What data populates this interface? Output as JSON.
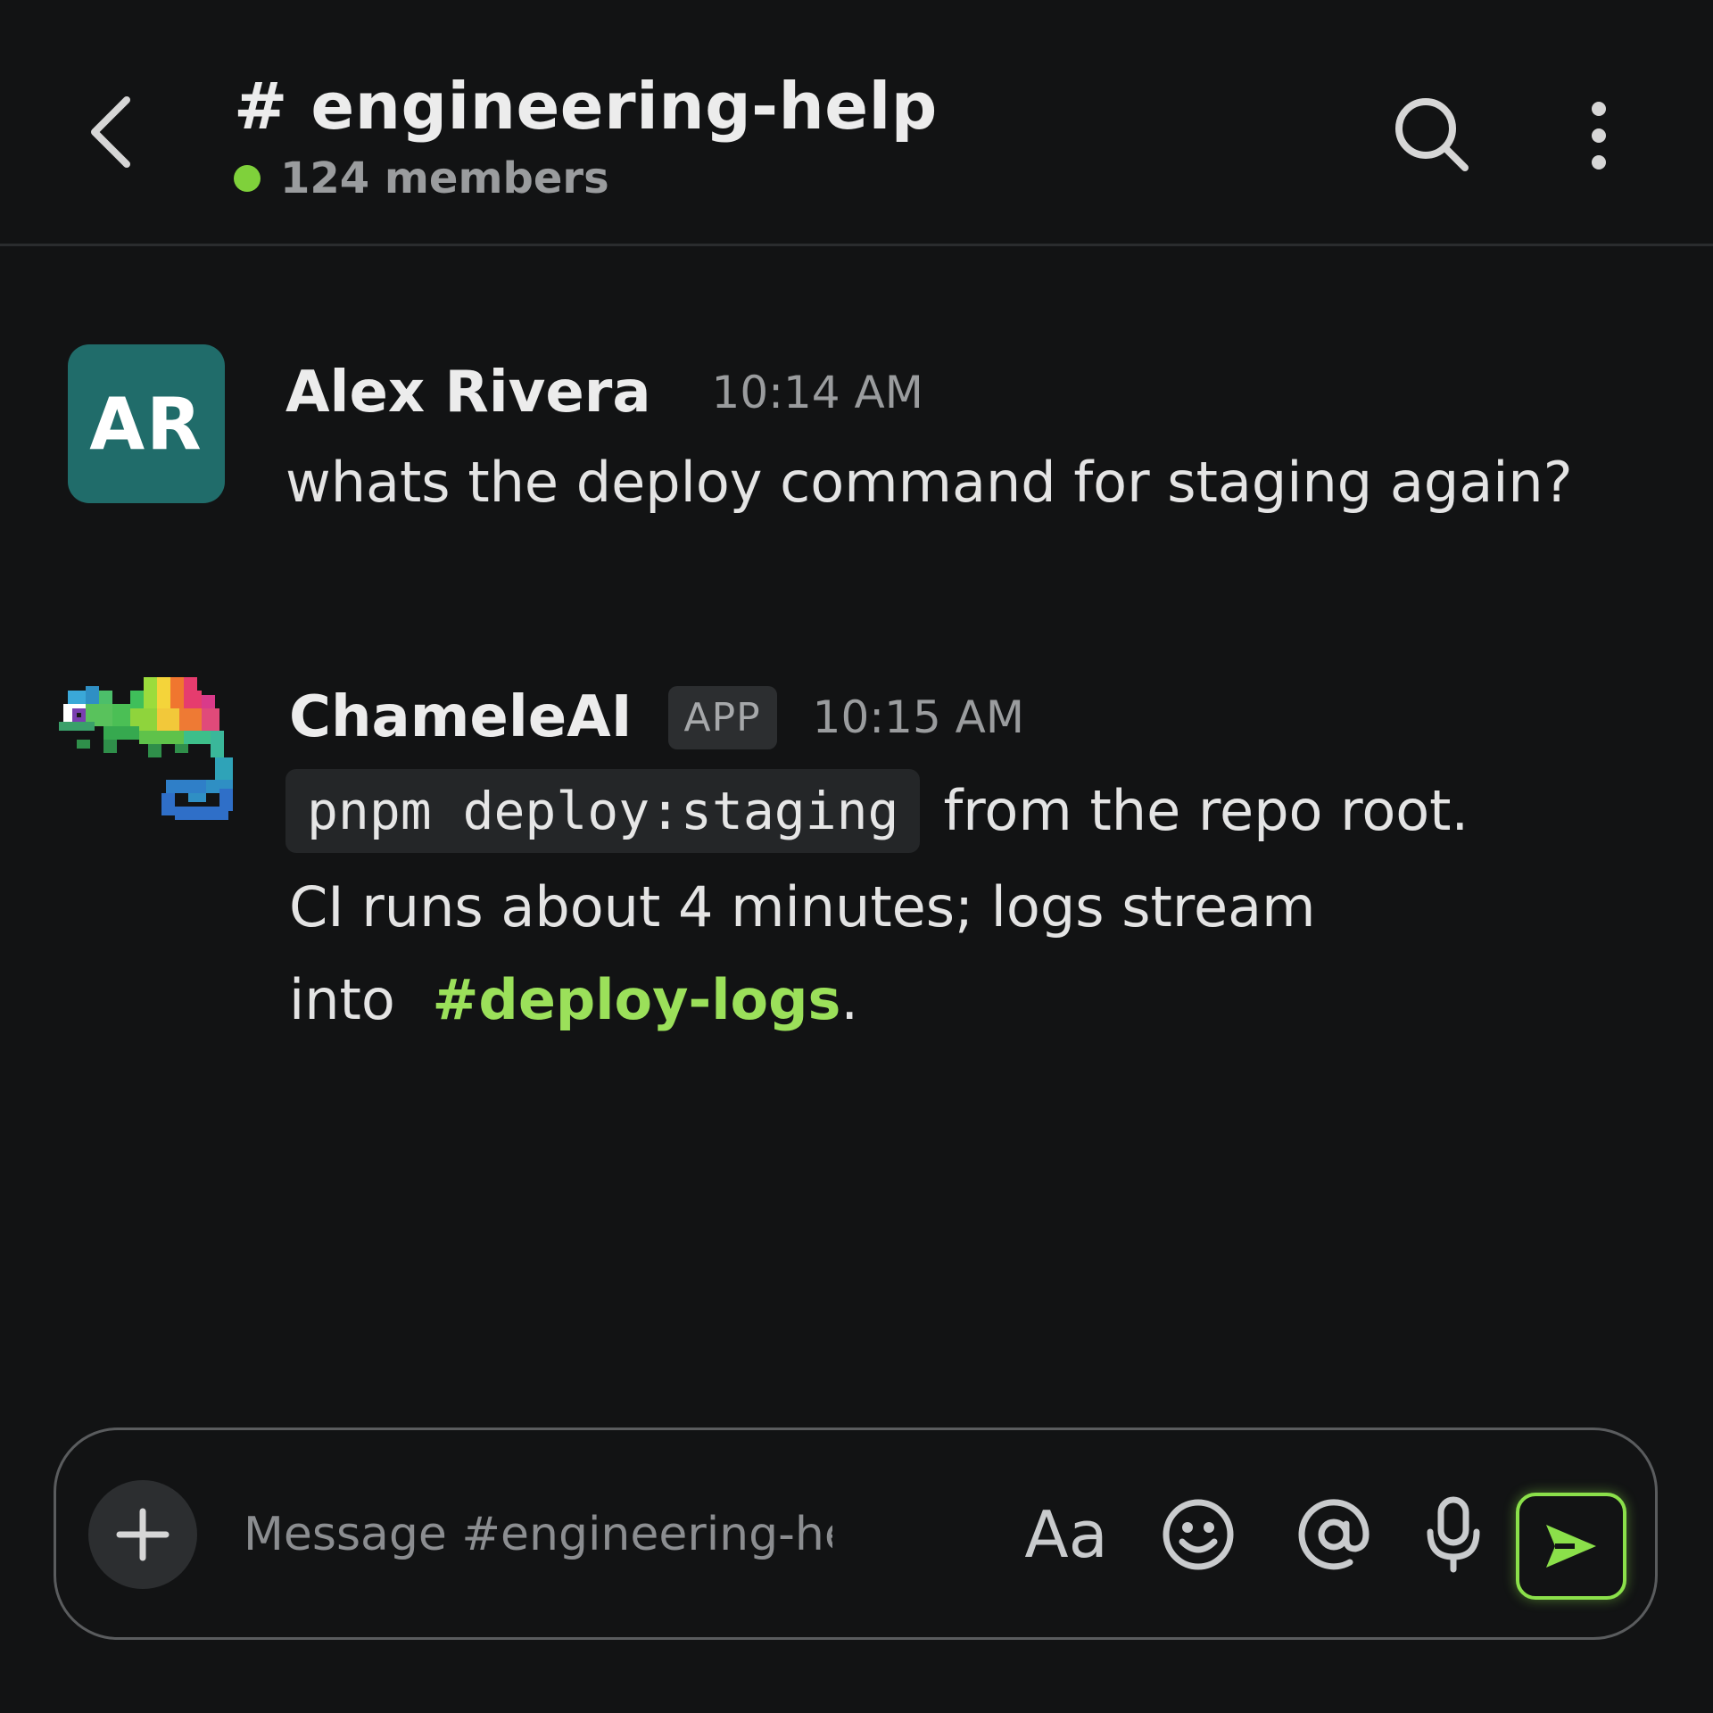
{
  "header": {
    "channel_title": "# engineering-help",
    "members_label": "124 members",
    "presence_color": "#7fd13b",
    "icons": {
      "back": "chevron-left-icon",
      "search": "search-icon",
      "more": "more-vertical-icon"
    }
  },
  "messages": [
    {
      "author": "Alex Rivera",
      "initials": "AR",
      "avatar_color": "#206c6a",
      "time": "10:14 AM",
      "text": "whats the deploy command for staging again?"
    },
    {
      "author": "ChameleAI",
      "badge": "APP",
      "avatar": "chameleon-logo",
      "time": "10:15 AM",
      "code": "pnpm deploy:staging",
      "text_after_code": "from the repo root.",
      "line2": "CI runs about 4 minutes; logs stream",
      "line3_prefix": "into",
      "channel_link": "#deploy-logs",
      "line3_suffix": "."
    }
  ],
  "composer": {
    "placeholder": "Message #engineering-help",
    "format_label": "Aa",
    "icons": {
      "add": "plus-icon",
      "emoji": "emoji-icon",
      "mention": "at-icon",
      "mic": "microphone-icon",
      "send": "send-icon"
    }
  },
  "colors": {
    "background": "#121314",
    "accent": "#8be04a",
    "link": "#9be05a"
  }
}
